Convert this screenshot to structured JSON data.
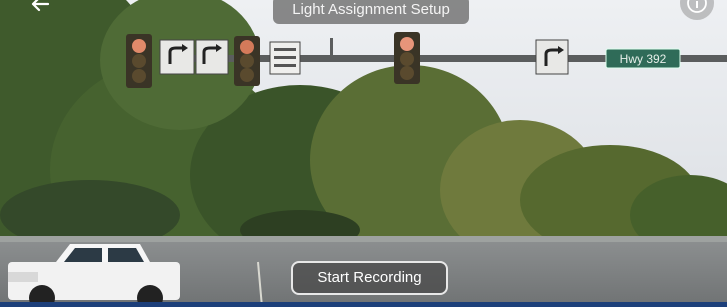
{
  "header": {
    "title": "Light Assignment Setup",
    "back_icon": "arrow-left-icon",
    "info_icon": "info-icon"
  },
  "camera_view": {
    "street_sign": "Hwy 392",
    "traffic_lights_visible": 3,
    "turn_signs_visible": 3
  },
  "controls": {
    "start_recording_label": "Start Recording"
  },
  "colors": {
    "pill_background": "#707070",
    "bottom_strip": "#1c3f7a"
  }
}
